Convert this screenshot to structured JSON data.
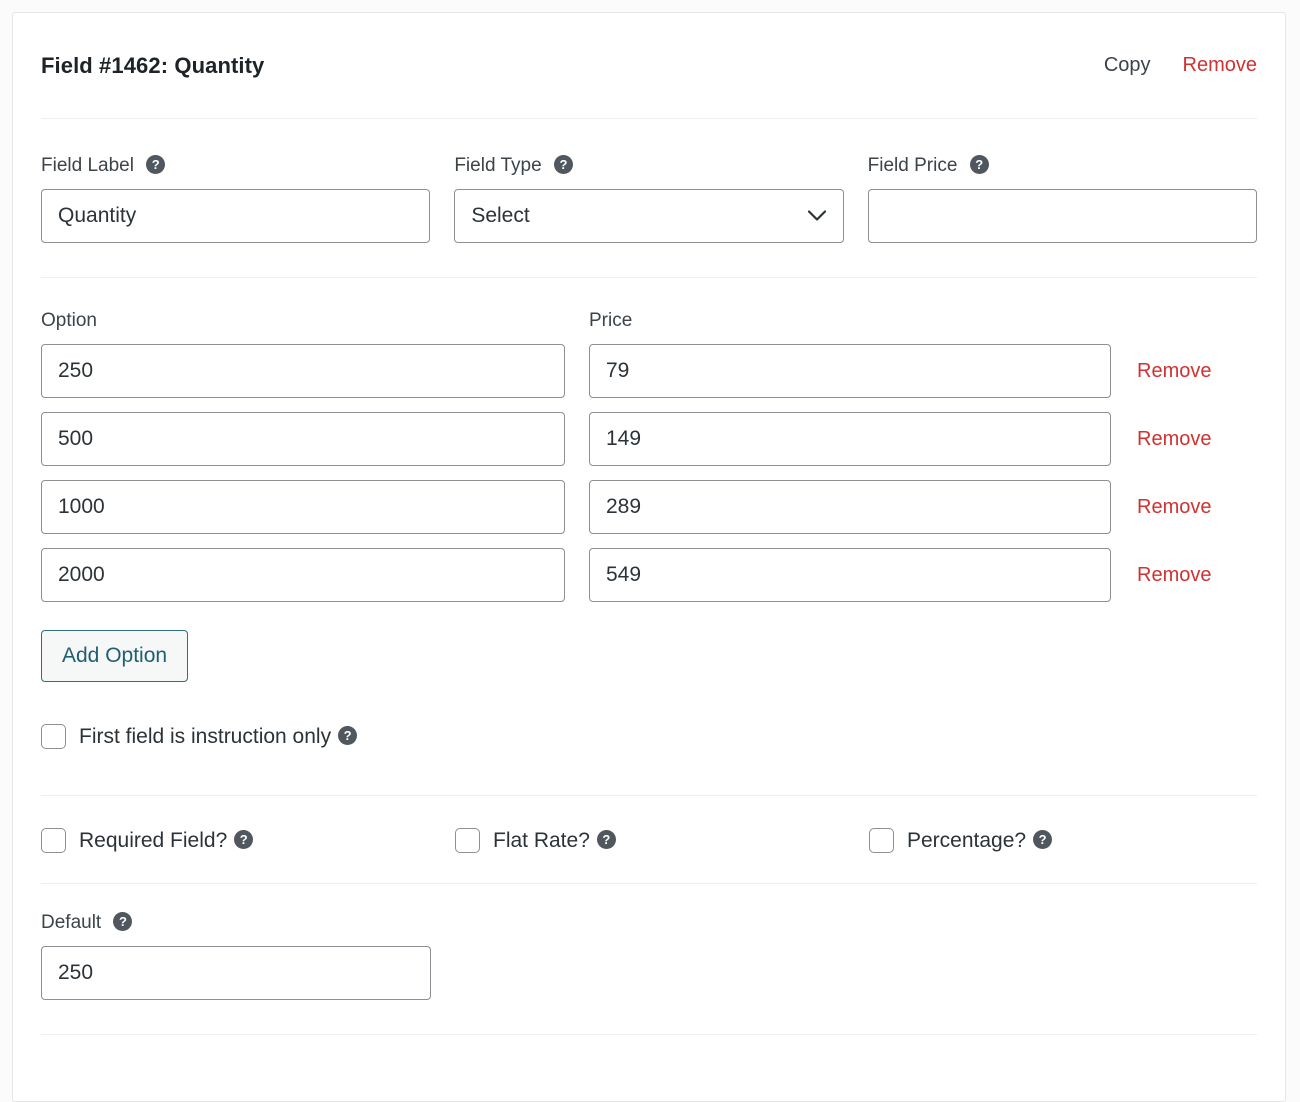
{
  "card": {
    "title": "Field #1462: Quantity",
    "copy_label": "Copy",
    "remove_label": "Remove"
  },
  "icons": {
    "help": "?",
    "help_name": "help-icon",
    "chevron": "chevron-down-icon"
  },
  "fields": {
    "field_label": {
      "label": "Field Label",
      "value": "Quantity",
      "placeholder": ""
    },
    "field_type": {
      "label": "Field Type",
      "value": "Select",
      "options": [
        "Select"
      ]
    },
    "field_price": {
      "label": "Field Price",
      "value": "",
      "placeholder": ""
    }
  },
  "options_section": {
    "option_header": "Option",
    "price_header": "Price",
    "remove_label": "Remove",
    "add_option_label": "Add Option",
    "rows": [
      {
        "option": "250",
        "price": "79"
      },
      {
        "option": "500",
        "price": "149"
      },
      {
        "option": "1000",
        "price": "289"
      },
      {
        "option": "2000",
        "price": "549"
      }
    ]
  },
  "checkboxes": {
    "instruction_only": {
      "label": "First field is instruction only",
      "checked": false
    },
    "required_field": {
      "label": "Required Field?",
      "checked": false
    },
    "flat_rate": {
      "label": "Flat Rate?",
      "checked": false
    },
    "percentage": {
      "label": "Percentage?",
      "checked": false
    }
  },
  "default_section": {
    "label": "Default",
    "value": "250",
    "placeholder": ""
  },
  "colors": {
    "remove_red": "#d23131",
    "button_teal": "#1f5f70",
    "text_dark": "#2c3338",
    "label_gray": "#3c434a",
    "border_gray": "#8c8f94",
    "help_bg": "#50575e"
  }
}
